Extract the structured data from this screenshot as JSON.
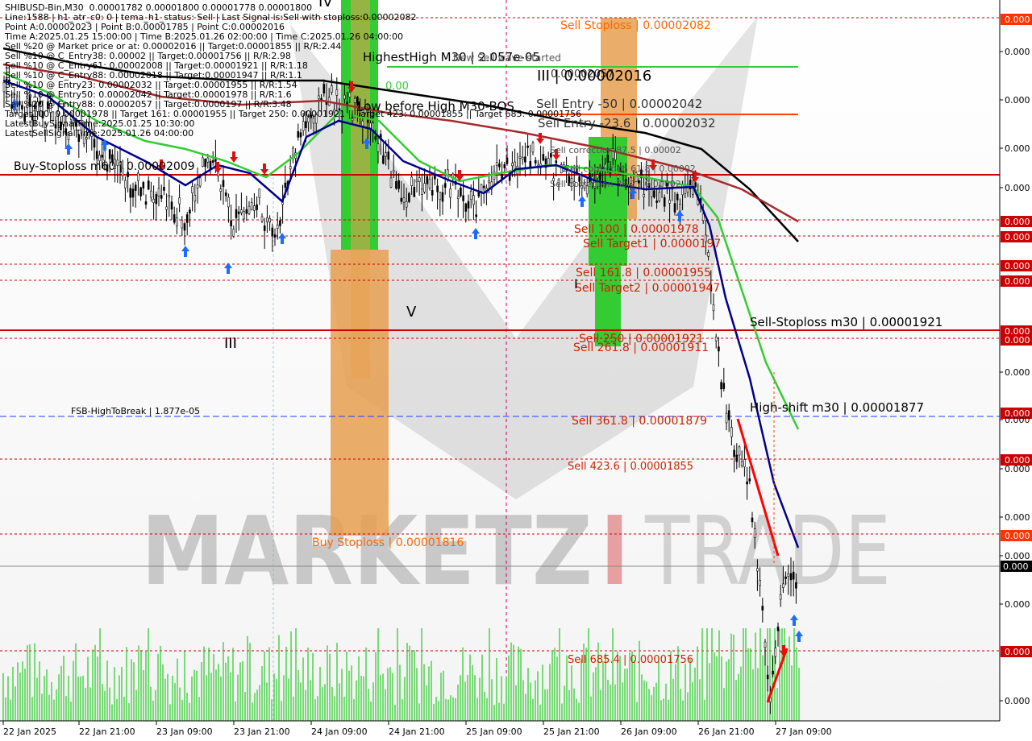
{
  "info_lines": [
    "SHIBUSD-Bin,M30  0.00001782 0.00001800 0.00001778 0.00001800",
    "Line:1588 | h1_atr_c0: 0 | tema_h1_status: Sell | Last Signal is:Sell with stoploss:0.00002082",
    "Point A:0.00002023 | Point B:0.00001785 | Point C:0.00002016",
    "Time A:2025.01.25 15:00:00 | Time B:2025.01.26 02:00:00 | Time C:2025.01.26 04:00:00",
    "Sell %20 @ Market price or at: 0.00002016 || Target:0.00001855 || R/R:2.44",
    "Sell %10 @ C_Entry38: 0.00002 || Target:0.00001756 || R/R:2.98",
    "Sell %10 @ C_Entry61: 0.00002008 || Target:0.00001921 || R/R:1.18",
    "Sell %10 @ C_Entry88: 0.00002018 || Target:0.00001947 || R/R:1.1",
    "Sell %10 @ Entry23: 0.00002032 || Target:0.00001955 || R/R:1.54",
    "Sell %10 @ Entry50: 0.00002042 || Target:0.00001978 || R/R:1.6",
    "Sell %20 @ Entry88: 0.00002057 || Target:0.0000197 || R/R:3.48",
    "Target100: 0.00001978 || Target 161: 0.00001955 || Target 250: 0.00001921 || Target 423: 0.00001855 || Target 685: 0.00001756",
    "LatestBuySignalTime:2025.01.25 10:30:00",
    "LatestSellSignalTime:2025.01.26 04:00:00"
  ],
  "chart_labels": {
    "sell_stoploss": "Sell Stoploss | 0.00002082",
    "highest_high": "HighestHigh   M30 | 2.057e-05",
    "new_sell_wave": "New Sell wave started",
    "wave_label_top": "0.00002057",
    "iii_price": "III | 0.00002016",
    "sell_entry_50": "Sell Entry -50 | 0.00002042",
    "sell_entry_23": "Sell Entry -23.6 | 0.00002032",
    "low_before_high": "Low before High   M30-BOS",
    "sell_correction_875": "Sell correction 87.5 | 0.00002",
    "sell_correction_618": "Sell correction 61.8 | 0.00002",
    "sell_correction_38": "Sell correction 38.2 | 0.00002",
    "buy_stoploss_m60": "Buy-Stoploss m60 | 0.00002009",
    "sell_100": "Sell 100 | 0.00001978",
    "sell_target1": "Sell Target1 | 0.0000197",
    "sell_161": "Sell 161.8 | 0.00001955",
    "sell_target2": "Sell Target2 | 0.00001947",
    "v_label": "V",
    "iii_label": "III",
    "iv_label": "IV",
    "sell_stoploss_m30": "Sell-Stoploss m30 | 0.00001921",
    "sell_250": "Sell 250 | 0.00001921",
    "sell_261": "Sell 261.8 | 0.00001911",
    "fsb": "FSB-HighToBreak | 1.877e-05",
    "high_shift": "High-shift m30 | 0.00001877",
    "sell_361": "Sell 361.8 | 0.00001879",
    "sell_423": "Sell 423.6 | 0.00001855",
    "buy_stoploss": "Buy Stoploss | 0.00001816",
    "sell_685": "Sell 685.4 | 0.00001756",
    "v_value": "0.00",
    "small_e": "I"
  },
  "price_axis": {
    "labels": [
      "0.000",
      "0.000",
      "0.000",
      "0.000",
      "0.000",
      "0.000",
      "0.000",
      "0.000",
      "0.000",
      "0.000",
      "0.000",
      "0.000",
      "0.000",
      "0.000",
      "0.000",
      "0.000",
      "0.000",
      "0.000",
      "0.000",
      "0.000",
      "0.000",
      "0.000",
      "0.000"
    ],
    "current": "0.000"
  },
  "time_axis": {
    "labels": [
      "22 Jan 2025",
      "22 Jan 21:00",
      "23 Jan 09:00",
      "23 Jan 21:00",
      "24 Jan 09:00",
      "24 Jan 21:00",
      "25 Jan 09:00",
      "25 Jan 21:00",
      "26 Jan 09:00",
      "26 Jan 21:00",
      "27 Jan 09:00"
    ]
  },
  "watermark": {
    "part1": "MARKETZ",
    "part2": "I",
    "part3": "TRADE"
  },
  "colors": {
    "red_level": "#cc0000",
    "orange_zone": "#e8a050",
    "green_zone": "#33cc33",
    "ma_black": "#000000",
    "ma_red": "#a52a2a",
    "ma_green": "#33cc33",
    "ma_blue": "#00008b",
    "fsb_blue": "#1e3cff"
  }
}
